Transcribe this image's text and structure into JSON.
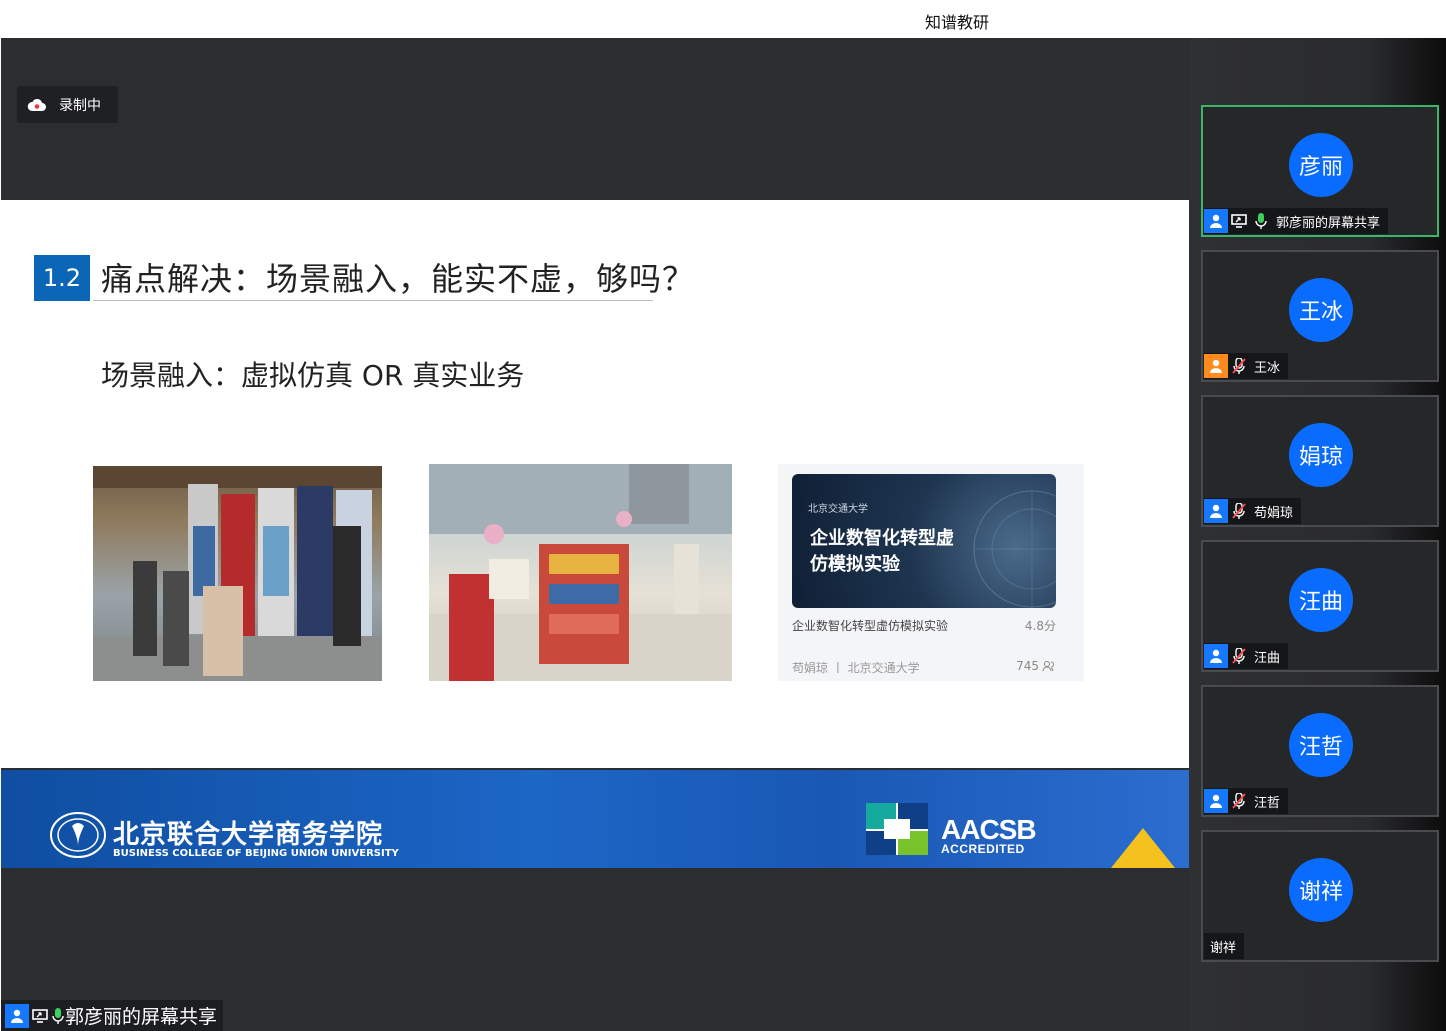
{
  "window": {
    "title": "知谱教研"
  },
  "recording": {
    "label": "录制中"
  },
  "slide": {
    "section_number": "1.2",
    "title": "痛点解决：场景融入，能实不虚，够吗？",
    "subtitle": "场景融入：虚拟仿真 OR 真实业务",
    "course_card": {
      "banner_logo": "北京交通大学",
      "banner_title": "企业数智化转型虚仿模拟实验",
      "name": "企业数智化转型虚仿模拟实验",
      "score": "4.8分",
      "teacher_school": "苟娟琼 丨 北京交通大学",
      "count": "745"
    },
    "footer": {
      "university_cn": "北京联合大学商务学院",
      "university_en": "BUSINESS COLLEGE OF BEIJING UNION UNIVERSITY",
      "aacsb": "AACSB",
      "aacsb_sub": "ACCREDITED"
    }
  },
  "share_label": "郭彦丽的屏幕共享",
  "participants": [
    {
      "avatar": "彦丽",
      "label": "郭彦丽的屏幕共享",
      "active": true
    },
    {
      "avatar": "王冰",
      "label": "王冰"
    },
    {
      "avatar": "娟琼",
      "label": "苟娟琼"
    },
    {
      "avatar": "汪曲",
      "label": "汪曲"
    },
    {
      "avatar": "汪哲",
      "label": "汪哲"
    },
    {
      "avatar": "谢祥",
      "label": "谢祥"
    }
  ],
  "colors": {
    "accent_blue": "#0b66b8",
    "avatar_blue": "#0a6cff",
    "active_border": "#3ab56a",
    "stage_bg": "#2b2d31"
  }
}
